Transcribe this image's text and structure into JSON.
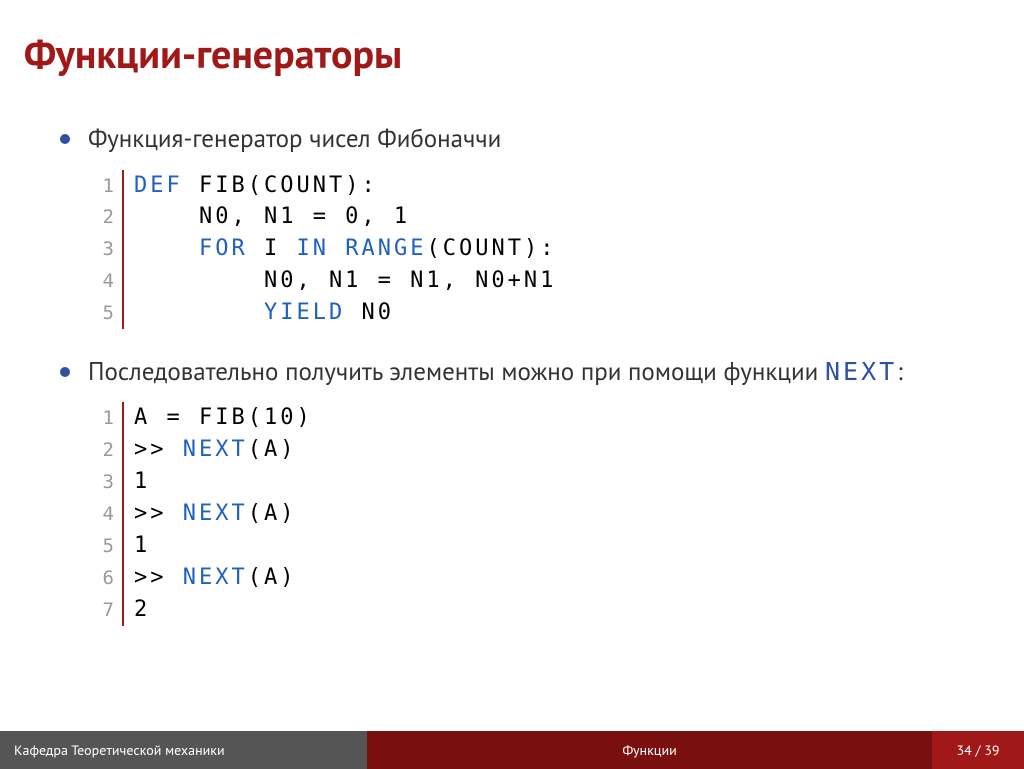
{
  "title": "Функции-генераторы",
  "bullet1": "Функция-генератор чисел Фибоначчи",
  "bullet2_prefix": "Последовательно получить элементы можно при помощи функции ",
  "bullet2_code": "NEXT",
  "bullet2_suffix": ":",
  "code1": {
    "lines": [
      {
        "n": "1",
        "tokens": [
          {
            "t": "DEF",
            "c": "kw"
          },
          {
            "t": " ",
            "c": "plain"
          },
          {
            "t": "FIB",
            "c": "plain"
          },
          {
            "t": "(",
            "c": "plain"
          },
          {
            "t": "COUNT",
            "c": "plain"
          },
          {
            "t": "):",
            "c": "plain"
          }
        ]
      },
      {
        "n": "2",
        "tokens": [
          {
            "t": "    N0, N1 = 0, 1",
            "c": "plain"
          }
        ]
      },
      {
        "n": "3",
        "tokens": [
          {
            "t": "    ",
            "c": "plain"
          },
          {
            "t": "FOR",
            "c": "kw"
          },
          {
            "t": " I ",
            "c": "plain"
          },
          {
            "t": "IN",
            "c": "kw"
          },
          {
            "t": " ",
            "c": "plain"
          },
          {
            "t": "RANGE",
            "c": "kw"
          },
          {
            "t": "(",
            "c": "plain"
          },
          {
            "t": "COUNT",
            "c": "plain"
          },
          {
            "t": "):",
            "c": "plain"
          }
        ]
      },
      {
        "n": "4",
        "tokens": [
          {
            "t": "        N0, N1 = N1, N0+N1",
            "c": "plain"
          }
        ]
      },
      {
        "n": "5",
        "tokens": [
          {
            "t": "        ",
            "c": "plain"
          },
          {
            "t": "YIELD",
            "c": "kw"
          },
          {
            "t": " N0",
            "c": "plain"
          }
        ]
      }
    ]
  },
  "code2": {
    "lines": [
      {
        "n": "1",
        "tokens": [
          {
            "t": "A = ",
            "c": "plain"
          },
          {
            "t": "FIB",
            "c": "plain"
          },
          {
            "t": "(10)",
            "c": "plain"
          }
        ]
      },
      {
        "n": "2",
        "tokens": [
          {
            "t": ">> ",
            "c": "plain"
          },
          {
            "t": "NEXT",
            "c": "kw"
          },
          {
            "t": "(A)",
            "c": "plain"
          }
        ]
      },
      {
        "n": "3",
        "tokens": [
          {
            "t": "1",
            "c": "plain"
          }
        ]
      },
      {
        "n": "4",
        "tokens": [
          {
            "t": ">> ",
            "c": "plain"
          },
          {
            "t": "NEXT",
            "c": "kw"
          },
          {
            "t": "(A)",
            "c": "plain"
          }
        ]
      },
      {
        "n": "5",
        "tokens": [
          {
            "t": "1",
            "c": "plain"
          }
        ]
      },
      {
        "n": "6",
        "tokens": [
          {
            "t": ">> ",
            "c": "plain"
          },
          {
            "t": "NEXT",
            "c": "kw"
          },
          {
            "t": "(A)",
            "c": "plain"
          }
        ]
      },
      {
        "n": "7",
        "tokens": [
          {
            "t": "2",
            "c": "plain"
          }
        ]
      }
    ]
  },
  "footer": {
    "left": "Кафедра Теоретической механики",
    "center": "Функции",
    "right": "34 / 39"
  }
}
